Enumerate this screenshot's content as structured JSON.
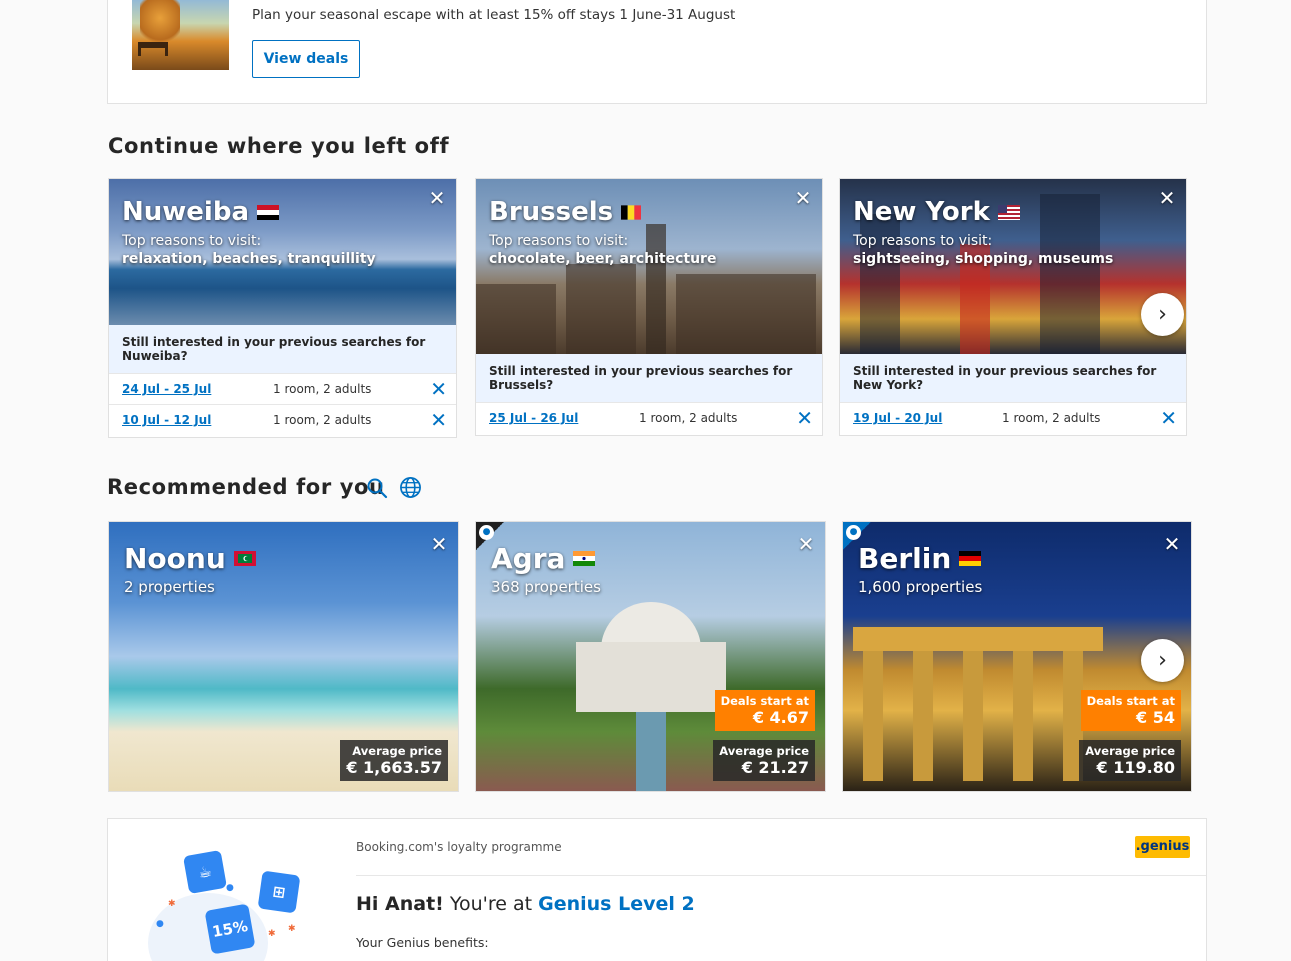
{
  "promo": {
    "text": "Plan your seasonal escape with at least 15% off stays 1 June-31 August",
    "button": "View deals"
  },
  "continue": {
    "title": "Continue where you left off",
    "cards": [
      {
        "city": "Nuweiba",
        "flag": "egypt-flag",
        "reason_label": "Top reasons to visit:",
        "reasons": "relaxation, beaches, tranquillity",
        "still": "Still interested in your previous searches for Nuweiba?",
        "searches": [
          {
            "dates": "24 Jul - 25 Jul",
            "guests": "1 room, 2 adults"
          },
          {
            "dates": "10 Jul - 12 Jul",
            "guests": "1 room, 2 adults"
          }
        ]
      },
      {
        "city": "Brussels",
        "flag": "belgium-flag",
        "reason_label": "Top reasons to visit:",
        "reasons": "chocolate, beer, architecture",
        "still": "Still interested in your previous searches for Brussels?",
        "searches": [
          {
            "dates": "25 Jul - 26 Jul",
            "guests": "1 room, 2 adults"
          }
        ]
      },
      {
        "city": "New York",
        "flag": "usa-flag",
        "reason_label": "Top reasons to visit:",
        "reasons": "sightseeing, shopping, museums",
        "still": "Still interested in your previous searches for New York?",
        "searches": [
          {
            "dates": "19 Jul - 20 Jul",
            "guests": "1 room, 2 adults"
          }
        ]
      }
    ]
  },
  "recommended": {
    "title": "Recommended for you",
    "cards": [
      {
        "city": "Noonu",
        "flag": "maldives-flag",
        "properties": "2 properties",
        "avg_label": "Average price",
        "avg_price": "€ 1,663.57"
      },
      {
        "city": "Agra",
        "flag": "india-flag",
        "properties": "368 properties",
        "deal_label": "Deals start at",
        "deal_price": "€ 4.67",
        "avg_label": "Average price",
        "avg_price": "€ 21.27"
      },
      {
        "city": "Berlin",
        "flag": "germany-flag",
        "properties": "1,600 properties",
        "deal_label": "Deals start at",
        "deal_price": "€ 54",
        "avg_label": "Average price",
        "avg_price": "€ 119.80"
      }
    ]
  },
  "genius": {
    "programme": "Booking.com's loyalty programme",
    "logo": ".genius",
    "greeting_name": "Hi Anat!",
    "greeting_mid": " You're at ",
    "level": "Genius Level 2",
    "benefits": "Your Genius benefits:",
    "badge": "15%"
  },
  "colors": {
    "brand_blue": "#0071c2",
    "deal_orange": "#ff8000",
    "genius_yellow": "#febb02"
  }
}
